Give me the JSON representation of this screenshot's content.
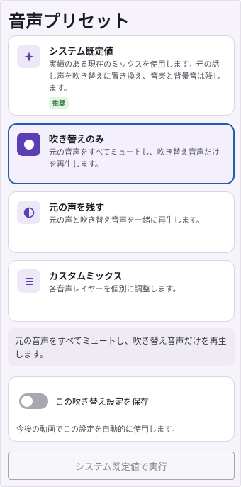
{
  "page": {
    "title": "音声プリセット"
  },
  "presets": [
    {
      "icon": "sparkle-icon",
      "title": "システム既定値",
      "description": "実績のある現在のミックスを使用します。元の話し声を吹き替えに置き換え、音楽と背景音は残します。",
      "badge": "推奨",
      "selected": false
    },
    {
      "icon": "record-circle-icon",
      "title": "吹き替えのみ",
      "description": "元の音声をすべてミュートし、吹き替え音声だけを再生します。",
      "selected": true
    },
    {
      "icon": "half-circle-icon",
      "title": "元の声を残す",
      "description": "元の声と吹き替え音声を一緒に再生します。",
      "selected": false
    },
    {
      "icon": "equalizer-icon",
      "title": "カスタムミックス",
      "description": "各音声レイヤーを個別に調整します。",
      "selected": false
    }
  ],
  "summary": {
    "text": "元の音声をすべてミュートし、吹き替え音声だけを再生します。"
  },
  "save": {
    "toggle_label": "この吹き替え設定を保存",
    "toggle_on": false,
    "help": "今後の動画でこの設定を自動的に使用します。"
  },
  "run_button": {
    "label": "システム既定値で実行",
    "enabled": false
  },
  "colors": {
    "accent": "#5b3eb3",
    "selected_border": "#1f5fb0",
    "badge_bg": "#e3f4e6",
    "badge_text": "#2e7a3e"
  }
}
